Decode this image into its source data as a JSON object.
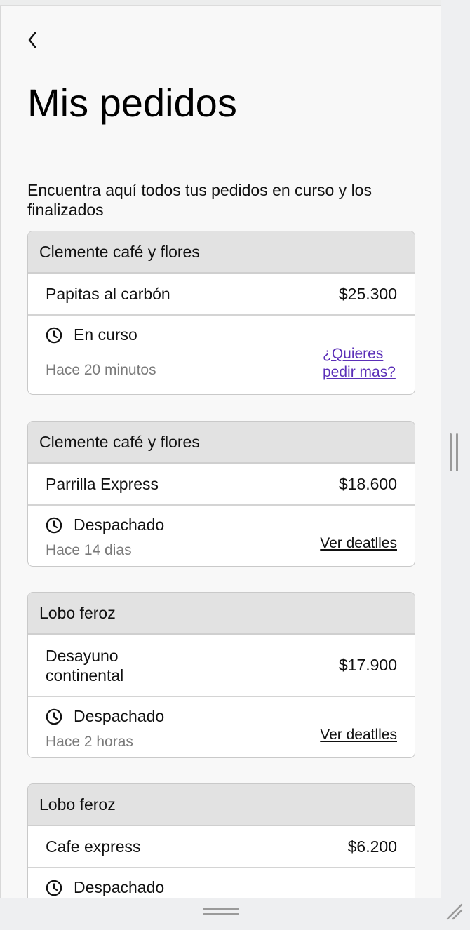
{
  "header": {
    "title": "Mis pedidos",
    "subtitle": "Encuentra aquí todos tus pedidos en curso y los finalizados"
  },
  "orders": [
    {
      "store": "Clemente café y flores",
      "item": "Papitas al carbón",
      "price": "$25.300",
      "status": "En curso",
      "time": "Hace 20 minutos",
      "action": "¿Quieres pedir mas?"
    },
    {
      "store": "Clemente café y flores",
      "item": "Parrilla Express",
      "price": "$18.600",
      "status": "Despachado",
      "time": "Hace 14 dias",
      "action": "Ver deatlles"
    },
    {
      "store": "Lobo feroz",
      "item": "Desayuno continental",
      "price": "$17.900",
      "status": "Despachado",
      "time": "Hace 2 horas",
      "action": "Ver deatlles"
    },
    {
      "store": "Lobo feroz",
      "item": "Cafe express",
      "price": "$6.200",
      "status": "Despachado"
    }
  ],
  "icons": {
    "back": "chevron-left-icon",
    "status": "clock-icon"
  },
  "colors": {
    "link_accent": "#5b2fb8",
    "header_bg": "#e2e2e2",
    "muted_text": "#7a7a7a"
  }
}
